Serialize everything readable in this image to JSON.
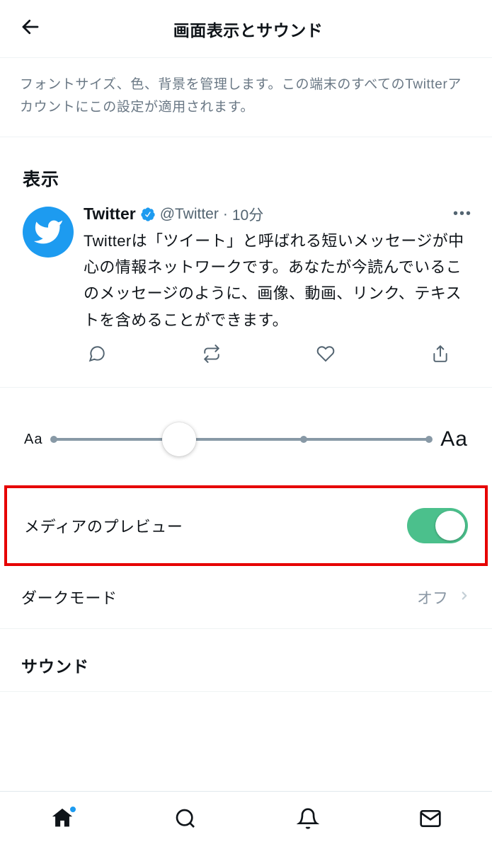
{
  "header": {
    "title": "画面表示とサウンド"
  },
  "description": "フォントサイズ、色、背景を管理します。この端末のすべてのTwitterアカウントにこの設定が適用されます。",
  "display_section": {
    "title": "表示"
  },
  "tweet_preview": {
    "name": "Twitter",
    "handle": "@Twitter",
    "separator": "·",
    "time": "10分",
    "text": "Twitterは「ツイート」と呼ばれる短いメッセージが中心の情報ネットワークです。あなたが今読んでいるこのメッセージのように、画像、動画、リンク、テキストを含めることができます。"
  },
  "font_slider": {
    "label_small": "Aa",
    "label_large": "Aa",
    "steps": 4,
    "value_index": 1
  },
  "settings": {
    "media_preview": {
      "label": "メディアのプレビュー",
      "enabled": true
    },
    "dark_mode": {
      "label": "ダークモード",
      "value": "オフ"
    }
  },
  "sound_section": {
    "title": "サウンド"
  }
}
